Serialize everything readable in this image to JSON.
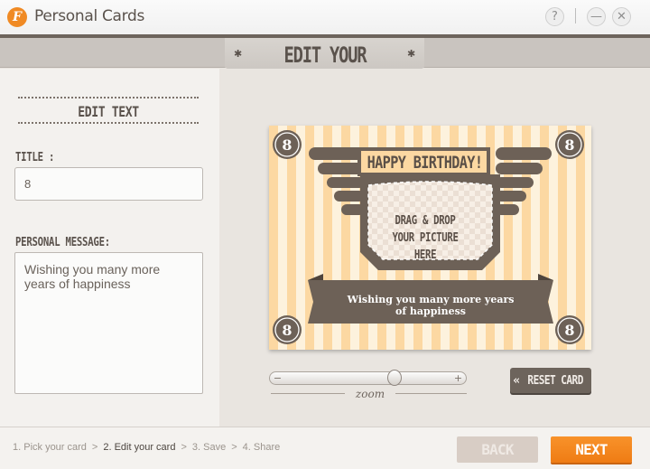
{
  "app": {
    "logo_letter": "F",
    "title": "Personal Cards",
    "help_label": "?",
    "minimize_label": "—",
    "close_label": "✕"
  },
  "header": {
    "title": "EDIT YOUR CARD",
    "star": "✱"
  },
  "edit_panel": {
    "heading": "EDIT TEXT",
    "title_label": "TITLE :",
    "title_value": "8",
    "message_label": "PERSONAL MESSAGE:",
    "message_value": "Wishing you many more years of happiness"
  },
  "card": {
    "headline": "HAPPY BIRTHDAY!",
    "drop_line1": "DRAG & DROP",
    "drop_line2": "YOUR PICTURE HERE",
    "message": "Wishing you many more years of happiness",
    "badge_value": "8",
    "stripe_colors": [
      "#fcd8a2",
      "#fdf2dd"
    ],
    "ink_color": "#6d6157"
  },
  "zoom": {
    "label": "zoom",
    "minus": "−",
    "plus": "+",
    "level": 0.66
  },
  "reset_button": {
    "icon": "«",
    "label": "RESET CARD"
  },
  "steps": [
    {
      "label": "1. Pick your card",
      "active": false
    },
    {
      "label": "2. Edit your card",
      "active": true
    },
    {
      "label": "3. Save",
      "active": false
    },
    {
      "label": "4. Share",
      "active": false
    }
  ],
  "step_separator": ">",
  "footer": {
    "back_label": "BACK",
    "next_label": "NEXT"
  },
  "colors": {
    "accent": "#f08a24",
    "dark": "#6d645c",
    "back_disabled": "#d8cdc5"
  }
}
